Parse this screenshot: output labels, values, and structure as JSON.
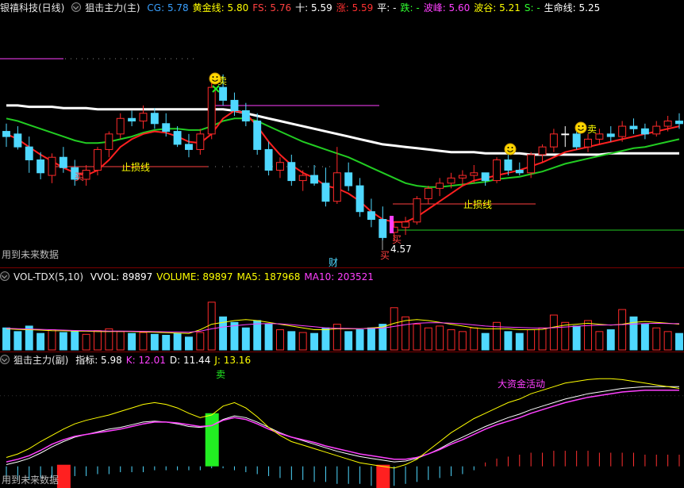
{
  "main_header": {
    "title": "银禧科技(日线)",
    "indicator": "狙击主力(主)",
    "items": [
      {
        "label": "CG: ",
        "value": "5.78",
        "color": "#39a0ff"
      },
      {
        "label": "黄金线: ",
        "value": "5.80",
        "color": "#ffff00"
      },
      {
        "label": "FS: ",
        "value": "5.76",
        "color": "#ff4040"
      },
      {
        "label": "十: ",
        "value": "5.59",
        "color": "#ffffff"
      },
      {
        "label": "涨: ",
        "value": "5.59",
        "color": "#ff3030"
      },
      {
        "label": "平: ",
        "value": "-",
        "color": "#ffffff"
      },
      {
        "label": "跌: ",
        "value": "-",
        "color": "#30ff30"
      },
      {
        "label": "波峰: ",
        "value": "5.60",
        "color": "#ff40ff"
      },
      {
        "label": "波谷: ",
        "value": "5.21",
        "color": "#ffff00"
      },
      {
        "label": "S: ",
        "value": "-",
        "color": "#30ff30"
      },
      {
        "label": "生命线: ",
        "value": "5.25",
        "color": "#ffffff"
      }
    ]
  },
  "main_annotations": {
    "buy1": "买",
    "stop1": "止损线",
    "sell1": "卖",
    "buy2": "买",
    "buy2b": "买",
    "low_price": "4.57",
    "cai": "财",
    "stop2": "止损线",
    "sell2": "卖",
    "future": "用到未来数据"
  },
  "vol_header": {
    "name": "VOL-TDX(5,10)",
    "items": [
      {
        "label": "VVOL: ",
        "value": "89897",
        "color": "#ffffff"
      },
      {
        "label": "VOLUME: ",
        "value": "89897",
        "color": "#ffff00"
      },
      {
        "label": "MA5: ",
        "value": "187968",
        "color": "#ffff00"
      },
      {
        "label": "MA10: ",
        "value": "203521",
        "color": "#ff40ff"
      }
    ]
  },
  "sub_header": {
    "name": "狙击主力(副)",
    "items": [
      {
        "label": "指标: ",
        "value": "5.98",
        "color": "#ffffff"
      },
      {
        "label": "K: ",
        "value": "12.01",
        "color": "#ff40ff"
      },
      {
        "label": "D: ",
        "value": "11.44",
        "color": "#ffffff"
      },
      {
        "label": "J: ",
        "value": "13.16",
        "color": "#ffff00"
      }
    ]
  },
  "sub_annotations": {
    "sell": "卖",
    "big_money": "大资金活动",
    "future": "用到未来数据"
  },
  "colors": {
    "up": "#ff2a2a",
    "down": "#4fd8ff",
    "flat": "#ffffff",
    "life": "#ffffff",
    "green_line": "#22cc22",
    "red_line": "#ff2020",
    "magenta": "#ff40ff",
    "yellow": "#ffff00",
    "separator": "#7a0000"
  },
  "chart_data": {
    "type": "candlestick",
    "price_range": [
      4.4,
      6.3
    ],
    "candles": [
      [
        5.42,
        5.48,
        5.3,
        5.38
      ],
      [
        5.4,
        5.46,
        5.28,
        5.3
      ],
      [
        5.3,
        5.38,
        5.1,
        5.2
      ],
      [
        5.2,
        5.26,
        5.05,
        5.1
      ],
      [
        5.08,
        5.25,
        5.02,
        5.22
      ],
      [
        5.22,
        5.3,
        5.1,
        5.14
      ],
      [
        5.14,
        5.2,
        5.0,
        5.05
      ],
      [
        5.05,
        5.16,
        5.0,
        5.12
      ],
      [
        5.12,
        5.3,
        5.08,
        5.28
      ],
      [
        5.28,
        5.42,
        5.22,
        5.4
      ],
      [
        5.4,
        5.56,
        5.36,
        5.52
      ],
      [
        5.52,
        5.58,
        5.46,
        5.5
      ],
      [
        5.5,
        5.62,
        5.44,
        5.56
      ],
      [
        5.56,
        5.6,
        5.44,
        5.48
      ],
      [
        5.48,
        5.56,
        5.38,
        5.42
      ],
      [
        5.42,
        5.46,
        5.3,
        5.32
      ],
      [
        5.32,
        5.4,
        5.22,
        5.28
      ],
      [
        5.28,
        5.44,
        5.24,
        5.4
      ],
      [
        5.4,
        5.8,
        5.36,
        5.76
      ],
      [
        5.76,
        5.86,
        5.62,
        5.66
      ],
      [
        5.66,
        5.72,
        5.54,
        5.58
      ],
      [
        5.58,
        5.64,
        5.46,
        5.5
      ],
      [
        5.5,
        5.56,
        5.24,
        5.28
      ],
      [
        5.28,
        5.34,
        5.08,
        5.12
      ],
      [
        5.12,
        5.22,
        5.06,
        5.18
      ],
      [
        5.18,
        5.24,
        5.0,
        5.04
      ],
      [
        5.04,
        5.12,
        4.96,
        5.08
      ],
      [
        5.08,
        5.16,
        5.0,
        5.02
      ],
      [
        5.02,
        5.14,
        4.84,
        4.88
      ],
      [
        4.88,
        5.3,
        4.86,
        5.1
      ],
      [
        5.1,
        5.18,
        4.96,
        5.0
      ],
      [
        5.0,
        5.06,
        4.76,
        4.8
      ],
      [
        4.8,
        4.9,
        4.68,
        4.74
      ],
      [
        4.74,
        4.84,
        4.58,
        4.6
      ],
      [
        4.64,
        4.72,
        4.57,
        4.68
      ],
      [
        4.68,
        4.76,
        4.62,
        4.72
      ],
      [
        4.72,
        4.92,
        4.7,
        4.9
      ],
      [
        4.9,
        5.0,
        4.86,
        4.98
      ],
      [
        4.98,
        5.06,
        4.92,
        5.02
      ],
      [
        5.02,
        5.1,
        4.98,
        5.06
      ],
      [
        5.06,
        5.12,
        5.0,
        5.08
      ],
      [
        5.08,
        5.16,
        5.02,
        5.1
      ],
      [
        5.1,
        5.1,
        5.0,
        5.04
      ],
      [
        5.04,
        5.22,
        5.02,
        5.2
      ],
      [
        5.2,
        5.24,
        5.08,
        5.12
      ],
      [
        5.12,
        5.18,
        5.08,
        5.1
      ],
      [
        5.1,
        5.26,
        5.06,
        5.24
      ],
      [
        5.24,
        5.32,
        5.18,
        5.3
      ],
      [
        5.3,
        5.44,
        5.26,
        5.4
      ],
      [
        5.4,
        5.46,
        5.3,
        5.4
      ],
      [
        5.4,
        5.42,
        5.28,
        5.3
      ],
      [
        5.3,
        5.4,
        5.26,
        5.36
      ],
      [
        5.36,
        5.44,
        5.32,
        5.4
      ],
      [
        5.4,
        5.46,
        5.34,
        5.38
      ],
      [
        5.38,
        5.5,
        5.34,
        5.46
      ],
      [
        5.46,
        5.52,
        5.4,
        5.44
      ],
      [
        5.44,
        5.48,
        5.36,
        5.4
      ],
      [
        5.4,
        5.5,
        5.38,
        5.46
      ],
      [
        5.46,
        5.54,
        5.42,
        5.5
      ],
      [
        5.5,
        5.56,
        5.44,
        5.48
      ]
    ],
    "life_line": [
      5.62,
      5.62,
      5.61,
      5.61,
      5.61,
      5.6,
      5.6,
      5.6,
      5.59,
      5.59,
      5.59,
      5.59,
      5.59,
      5.59,
      5.59,
      5.59,
      5.59,
      5.59,
      5.59,
      5.59,
      5.58,
      5.56,
      5.54,
      5.52,
      5.5,
      5.48,
      5.46,
      5.44,
      5.42,
      5.4,
      5.38,
      5.36,
      5.34,
      5.32,
      5.31,
      5.3,
      5.29,
      5.28,
      5.27,
      5.26,
      5.26,
      5.26,
      5.25,
      5.25,
      5.25,
      5.25,
      5.24,
      5.24,
      5.24,
      5.24,
      5.24,
      5.24,
      5.24,
      5.25,
      5.25,
      5.25,
      5.25,
      5.25,
      5.25,
      5.25
    ],
    "green_line": [
      5.52,
      5.5,
      5.47,
      5.44,
      5.41,
      5.38,
      5.35,
      5.33,
      5.33,
      5.34,
      5.36,
      5.38,
      5.41,
      5.43,
      5.44,
      5.44,
      5.43,
      5.43,
      5.46,
      5.5,
      5.52,
      5.52,
      5.5,
      5.46,
      5.42,
      5.38,
      5.34,
      5.31,
      5.28,
      5.25,
      5.22,
      5.18,
      5.14,
      5.1,
      5.06,
      5.02,
      5.0,
      4.99,
      4.99,
      5.0,
      5.01,
      5.02,
      5.03,
      5.05,
      5.06,
      5.07,
      5.09,
      5.11,
      5.14,
      5.17,
      5.19,
      5.21,
      5.23,
      5.25,
      5.27,
      5.29,
      5.3,
      5.32,
      5.34,
      5.36
    ],
    "red_line": [
      5.4,
      5.36,
      5.3,
      5.24,
      5.19,
      5.14,
      5.1,
      5.08,
      5.12,
      5.2,
      5.3,
      5.36,
      5.4,
      5.42,
      5.41,
      5.38,
      5.34,
      5.33,
      5.4,
      5.52,
      5.58,
      5.56,
      5.46,
      5.34,
      5.24,
      5.16,
      5.1,
      5.06,
      5.0,
      4.98,
      4.94,
      4.88,
      4.8,
      4.74,
      4.72,
      4.72,
      4.76,
      4.82,
      4.88,
      4.94,
      5.0,
      5.04,
      5.06,
      5.08,
      5.1,
      5.12,
      5.15,
      5.18,
      5.22,
      5.26,
      5.28,
      5.3,
      5.32,
      5.34,
      5.36,
      5.38,
      5.4,
      5.42,
      5.44,
      5.46
    ],
    "volume": {
      "max": 350000,
      "bars": [
        120000,
        100000,
        130000,
        90000,
        110000,
        95000,
        100000,
        85000,
        105000,
        115000,
        100000,
        90000,
        95000,
        85000,
        80000,
        90000,
        70000,
        95000,
        260000,
        180000,
        150000,
        120000,
        160000,
        140000,
        110000,
        100000,
        95000,
        90000,
        120000,
        140000,
        100000,
        110000,
        120000,
        140000,
        230000,
        180000,
        140000,
        120000,
        130000,
        110000,
        100000,
        120000,
        90000,
        150000,
        100000,
        90000,
        110000,
        120000,
        190000,
        150000,
        130000,
        160000,
        100000,
        110000,
        220000,
        180000,
        140000,
        120000,
        100000,
        90000
      ],
      "ma5": [
        115000,
        112000,
        110000,
        108000,
        105000,
        104000,
        103000,
        102000,
        100000,
        100000,
        101000,
        100000,
        98000,
        96000,
        94000,
        92000,
        90000,
        110000,
        140000,
        150000,
        160000,
        165000,
        160000,
        150000,
        140000,
        130000,
        120000,
        110000,
        110000,
        115000,
        115000,
        115000,
        120000,
        125000,
        145000,
        160000,
        165000,
        160000,
        150000,
        140000,
        130000,
        120000,
        115000,
        115000,
        115000,
        110000,
        110000,
        112000,
        125000,
        135000,
        140000,
        145000,
        140000,
        135000,
        140000,
        150000,
        155000,
        150000,
        145000,
        140000
      ],
      "ma10": [
        118000,
        116000,
        114000,
        112000,
        110000,
        108000,
        106000,
        105000,
        104000,
        103000,
        103000,
        102000,
        101000,
        100000,
        99000,
        98000,
        97000,
        102000,
        115000,
        125000,
        132000,
        138000,
        142000,
        144000,
        142000,
        138000,
        132000,
        126000,
        120000,
        118000,
        117000,
        116000,
        117000,
        119000,
        128000,
        138000,
        145000,
        148000,
        148000,
        146000,
        142000,
        136000,
        130000,
        126000,
        124000,
        122000,
        120000,
        119000,
        121000,
        125000,
        129000,
        133000,
        135000,
        136000,
        138000,
        141000,
        144000,
        145000,
        144000,
        143000
      ]
    },
    "sub": {
      "range": [
        -20,
        110
      ],
      "sticks": [
        -8,
        -7,
        -7,
        -6,
        -6,
        -5,
        -5,
        -5,
        -4,
        -4,
        -3,
        -3,
        -3,
        -2,
        -2,
        -2,
        -2,
        -2,
        -1,
        -1,
        -2,
        -3,
        -4,
        -5,
        -6,
        -7,
        -7,
        -8,
        -8,
        -9,
        -9,
        -9,
        -10,
        -10,
        -10,
        -9,
        -8,
        -7,
        -6,
        -5,
        -4,
        -2,
        2,
        4,
        5,
        6,
        7,
        7,
        8,
        8,
        8,
        8,
        7,
        7,
        7,
        7,
        6,
        6,
        6,
        6
      ],
      "k": [
        5,
        8,
        12,
        18,
        25,
        30,
        34,
        36,
        38,
        40,
        42,
        45,
        48,
        50,
        50,
        49,
        47,
        45,
        46,
        52,
        55,
        53,
        48,
        42,
        37,
        33,
        30,
        27,
        23,
        20,
        17,
        14,
        12,
        10,
        8,
        8,
        10,
        14,
        19,
        25,
        30,
        36,
        42,
        47,
        51,
        55,
        60,
        64,
        68,
        72,
        75,
        78,
        80,
        82,
        84,
        85,
        86,
        86,
        86,
        86
      ],
      "d": [
        2,
        5,
        9,
        15,
        22,
        28,
        33,
        36,
        39,
        42,
        44,
        47,
        50,
        51,
        50,
        48,
        45,
        44,
        46,
        53,
        57,
        55,
        50,
        44,
        38,
        33,
        29,
        25,
        21,
        17,
        14,
        11,
        9,
        7,
        5,
        6,
        9,
        14,
        20,
        27,
        33,
        39,
        45,
        50,
        55,
        59,
        64,
        68,
        72,
        76,
        79,
        82,
        84,
        86,
        88,
        89,
        90,
        90,
        90,
        90
      ],
      "j": [
        10,
        14,
        20,
        28,
        35,
        42,
        48,
        52,
        55,
        58,
        62,
        66,
        70,
        72,
        70,
        66,
        60,
        55,
        58,
        68,
        72,
        66,
        56,
        44,
        35,
        28,
        24,
        20,
        16,
        12,
        8,
        4,
        2,
        0,
        -2,
        2,
        8,
        18,
        28,
        38,
        46,
        54,
        60,
        66,
        72,
        76,
        82,
        86,
        90,
        94,
        96,
        98,
        99,
        99,
        98,
        96,
        94,
        92,
        90,
        88
      ],
      "red_blocks": [
        {
          "idx": 5,
          "value": -38
        },
        {
          "idx": 33,
          "value": -35
        }
      ],
      "green_blocks": [
        {
          "idx": 18,
          "value": 60
        }
      ]
    }
  }
}
